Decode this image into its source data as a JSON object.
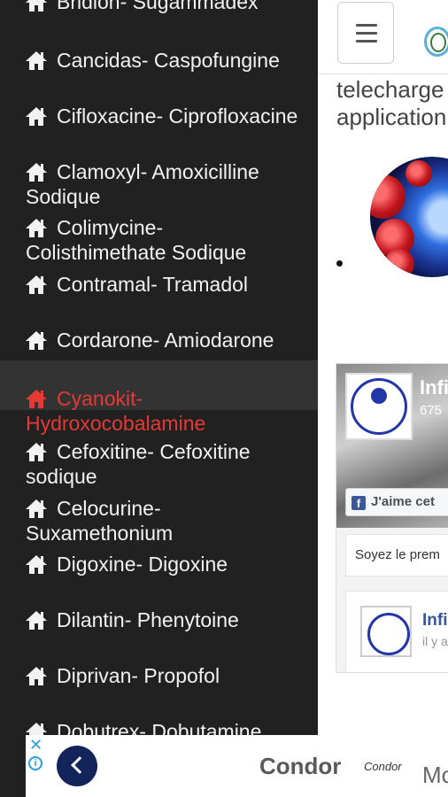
{
  "drawer": {
    "items": [
      {
        "label": "Bridion- Sugammadex",
        "active": false
      },
      {
        "label": "Cancidas- Caspofungine",
        "active": false
      },
      {
        "label": "Cifloxacine- Ciprofloxacine",
        "active": false
      },
      {
        "label": "Clamoxyl- Amoxicilline Sodique",
        "active": false
      },
      {
        "label": "Colimycine- Colisthimethate Sodique",
        "active": false
      },
      {
        "label": "Contramal- Tramadol",
        "active": false
      },
      {
        "label": "Cordarone- Amiodarone",
        "active": false
      },
      {
        "label": "Cyanokit- Hydroxocobalamine",
        "active": true
      },
      {
        "label": "Cefoxitine- Cefoxitine sodique",
        "active": false
      },
      {
        "label": "Celocurine- Suxamethonium",
        "active": false
      },
      {
        "label": "Digoxine- Digoxine",
        "active": false
      },
      {
        "label": "Dilantin- Phenytoine",
        "active": false
      },
      {
        "label": "Diprivan- Propofol",
        "active": false
      },
      {
        "label": "Dobutrex- Dobutamine",
        "active": false
      }
    ],
    "icon": "home-icon",
    "active_color": "#e53935"
  },
  "main": {
    "text_line1": "telecharge",
    "text_line2": "application",
    "facebook": {
      "page_name": "Infi",
      "count": "675",
      "like_label": "J'aime cet",
      "first_label": "Soyez le prem",
      "post_name": "Infi",
      "post_time": "il y a"
    },
    "bottom_partial": "Mc"
  },
  "ad": {
    "close_icon": "close-icon",
    "info_icon": "info-icon",
    "title": "Condor",
    "logo_text": "Condor"
  }
}
